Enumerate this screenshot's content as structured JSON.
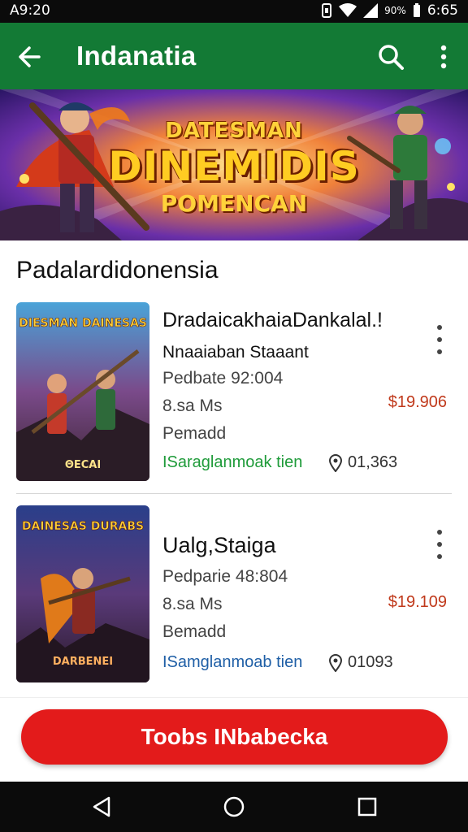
{
  "status_bar": {
    "time": "A9:20",
    "battery_text": "90%",
    "clock": "6:65"
  },
  "app_bar": {
    "title": "Indanatia",
    "back_icon": "arrow-left-icon",
    "search_icon": "search-icon",
    "more_icon": "more-vertical-icon"
  },
  "banner": {
    "line1": "DATESMAN",
    "line2": "DINEMIDIS",
    "line3": "POMENCAN"
  },
  "section": {
    "title": "Padalardidonensia"
  },
  "items": [
    {
      "thumb_title": "DIESMAN DAINESAS",
      "thumb_footer": "ΘECAI",
      "name": "DradaicakhaiaDankalal.!",
      "subtitle": "Nnaaiaban Staaant",
      "date": "Pedbate 92:004",
      "size": "8.sa Ms",
      "price": "$19.906",
      "extra": "Pemadd",
      "tag": "ISaraglanmoak tien",
      "tag_color": "#1f9b3a",
      "rating": "01,363"
    },
    {
      "thumb_title": "DAINESAS DURABS",
      "thumb_footer": "DARBENEI",
      "name": "Ualg,Staiga",
      "subtitle": "",
      "date": "Pedparie 48:804",
      "size": "8.sa Ms",
      "price": "$19.109",
      "extra": "Bemadd",
      "tag": "ISamglanmoab tien",
      "tag_color": "#1f5fa6",
      "rating": "01093"
    }
  ],
  "cta": {
    "label": "Toobs INbabecka"
  },
  "colors": {
    "app_bar": "#137a35",
    "cta": "#e31b1b",
    "price": "#c0391b"
  }
}
